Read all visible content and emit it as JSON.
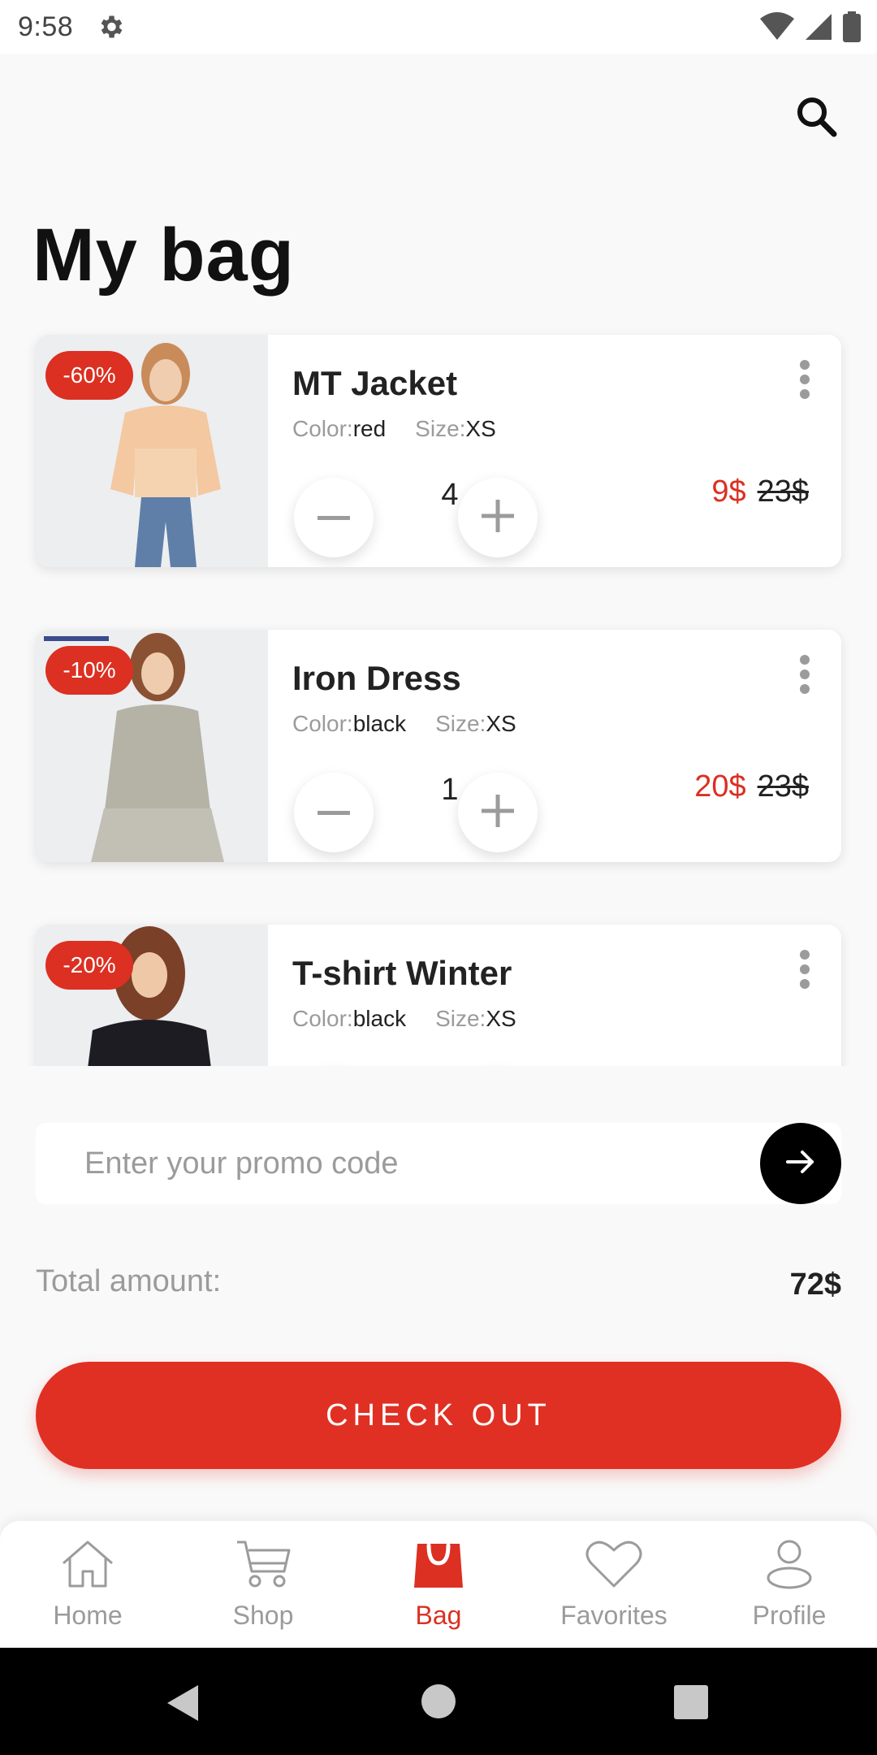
{
  "status_bar": {
    "time": "9:58"
  },
  "page": {
    "title": "My bag"
  },
  "items": [
    {
      "discount": "-60%",
      "name": "MT Jacket",
      "color_label": "Color:",
      "color": "red",
      "size_label": "Size:",
      "size": "XS",
      "qty": "4",
      "price": "9$",
      "old_price": "23$"
    },
    {
      "discount": "-10%",
      "name": "Iron Dress",
      "color_label": "Color:",
      "color": "black",
      "size_label": "Size:",
      "size": "XS",
      "qty": "1",
      "price": "20$",
      "old_price": "23$"
    },
    {
      "discount": "-20%",
      "name": "T-shirt Winter",
      "color_label": "Color:",
      "color": "black",
      "size_label": "Size:",
      "size": "XS",
      "qty": "",
      "price": "",
      "old_price": ""
    }
  ],
  "promo": {
    "placeholder": "Enter your promo code"
  },
  "total": {
    "label": "Total amount:",
    "value": "72$"
  },
  "checkout_label": "CHECK OUT",
  "nav": [
    {
      "label": "Home",
      "icon": "home-icon"
    },
    {
      "label": "Shop",
      "icon": "cart-icon"
    },
    {
      "label": "Bag",
      "icon": "bag-icon",
      "active": true
    },
    {
      "label": "Favorites",
      "icon": "heart-icon"
    },
    {
      "label": "Profile",
      "icon": "profile-icon"
    }
  ],
  "colors": {
    "accent": "#db3022",
    "background": "#f9f9f9"
  }
}
